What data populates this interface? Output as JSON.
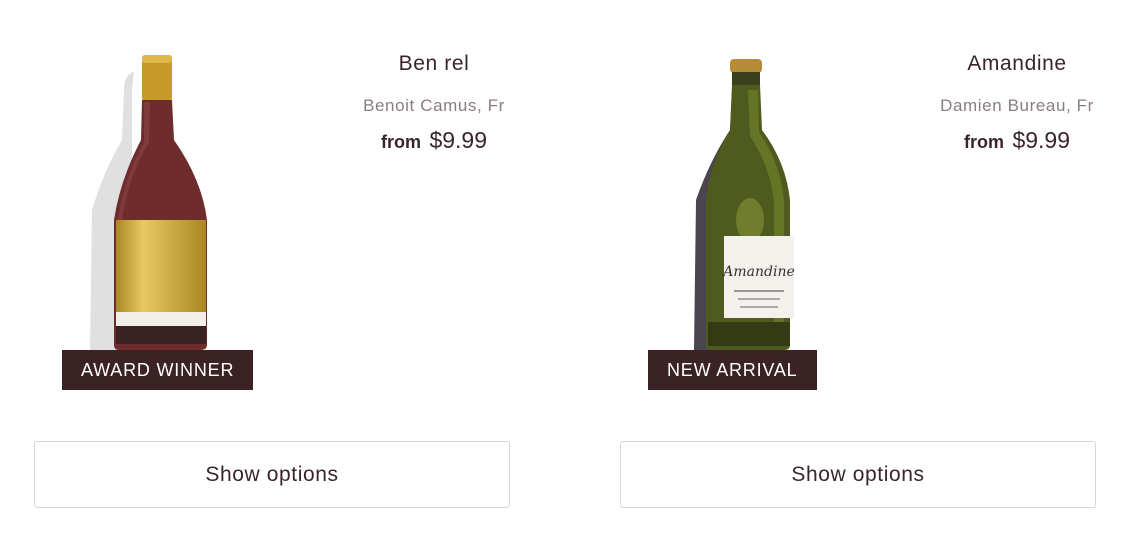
{
  "products": [
    {
      "name": "Ben rel",
      "producer": "Benoit Camus, Fr",
      "price_prefix": "from",
      "price": "$9.99",
      "badge": "AWARD WINNER",
      "button_label": "Show options",
      "bottle_icon": "red-wine-bottle-image"
    },
    {
      "name": "Amandine",
      "producer": "Damien Bureau, Fr",
      "price_prefix": "from",
      "price": "$9.99",
      "badge": "NEW ARRIVAL",
      "button_label": "Show options",
      "bottle_icon": "green-wine-bottle-image",
      "label_text": "Amandine"
    }
  ],
  "colors": {
    "badge_bg": "#3b2225",
    "text": "#3a2628",
    "muted_text": "#8a7d7f",
    "button_border": "#d8d4d4"
  }
}
